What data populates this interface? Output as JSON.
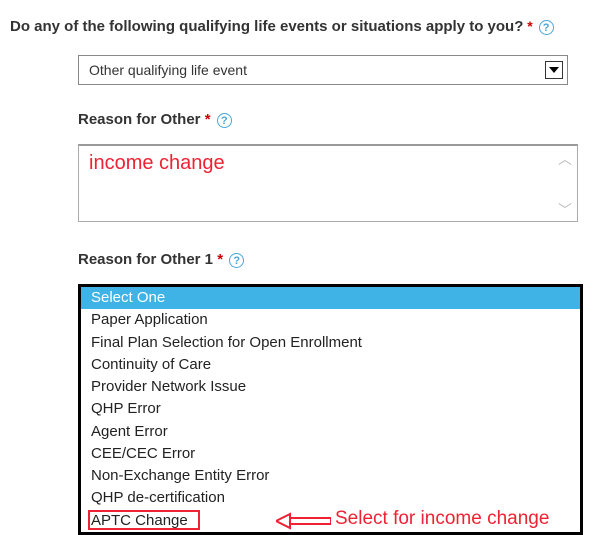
{
  "question": {
    "label": "Do any of the following qualifying life events or situations apply to you?",
    "required_mark": "*"
  },
  "life_event_select": {
    "value": "Other qualifying life event"
  },
  "reason_other": {
    "label": "Reason for Other",
    "required_mark": "*",
    "value": "income change"
  },
  "reason_other_1": {
    "label": "Reason for Other 1",
    "required_mark": "*",
    "options": [
      "Select One",
      "Paper Application",
      "Final Plan Selection for Open Enrollment",
      "Continuity of Care",
      "Provider Network Issue",
      "QHP Error",
      "Agent Error",
      "CEE/CEC Error",
      "Non-Exchange Entity Error",
      "QHP de-certification",
      "APTC Change"
    ],
    "highlighted_index": 0
  },
  "annotations": {
    "select_text": "Select for income change"
  }
}
